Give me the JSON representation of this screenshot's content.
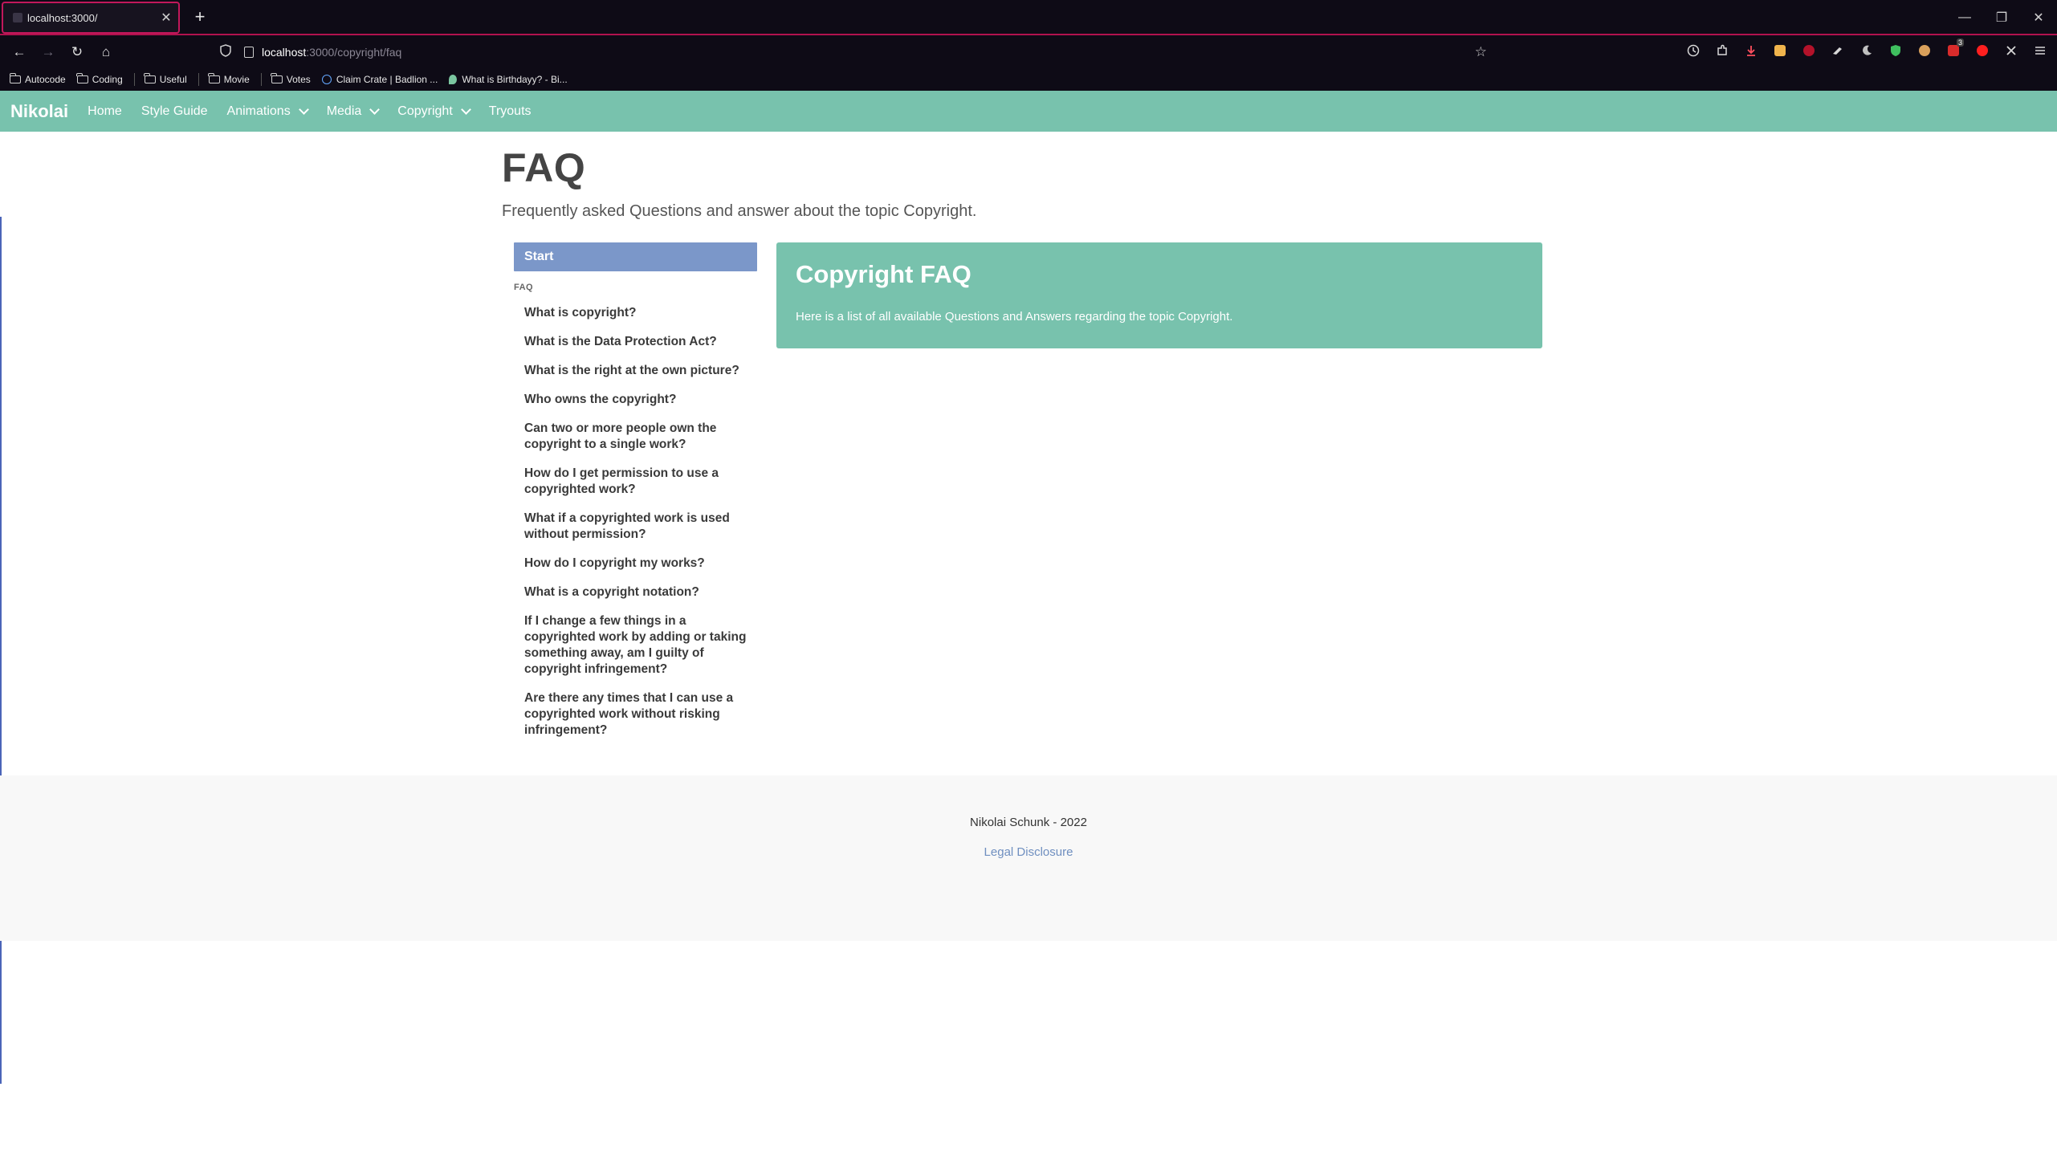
{
  "browser": {
    "tab": {
      "title": "localhost:3000/",
      "close": "✕"
    },
    "new_tab": "+",
    "window": {
      "minimize": "—",
      "restore": "❐",
      "close": "✕"
    },
    "nav": {
      "back": "←",
      "forward": "→",
      "reload": "↻",
      "home": "⌂"
    },
    "url": {
      "host": "localhost",
      "path": ":3000/copyright/faq"
    },
    "bookmark_star": "☆",
    "bookmarks": [
      {
        "label": "Autocode",
        "icon": "folder-icon"
      },
      {
        "label": "Coding",
        "icon": "folder-icon"
      },
      {
        "label": "Useful",
        "icon": "folder-icon"
      },
      {
        "label": "Movie",
        "icon": "folder-icon"
      },
      {
        "label": "Votes",
        "icon": "folder-icon"
      },
      {
        "label": "Claim Crate | Badlion ...",
        "icon": "globe-icon"
      },
      {
        "label": "What is Birthdayy? - Bi...",
        "icon": "leaf-icon"
      }
    ],
    "extension_badge": "3",
    "colors": {
      "chrome_bg": "#0e0b16",
      "tab_accent": "#c2185b"
    }
  },
  "site": {
    "brand": "Nikolai",
    "nav": {
      "home": "Home",
      "style_guide": "Style Guide",
      "animations": "Animations",
      "media": "Media",
      "copyright": "Copyright",
      "tryouts": "Tryouts"
    },
    "colors": {
      "primary": "#78c2ad",
      "secondary": "#7b97c9"
    }
  },
  "page": {
    "title": "FAQ",
    "lead": "Frequently asked Questions and answer about the topic Copyright."
  },
  "sidebar": {
    "start": "Start",
    "heading": "FAQ",
    "items": [
      "What is copyright?",
      "What is the Data Protection Act?",
      "What is the right at the own picture?",
      "Who owns the copyright?",
      "Can two or more people own the copyright to a single work?",
      "How do I get permission to use a copyrighted work?",
      "What if a copyrighted work is used without permission?",
      "How do I copyright my works?",
      "What is a copyright notation?",
      "If I change a few things in a copyrighted work by adding or taking something away, am I guilty of copyright infringement?",
      "Are there any times that I can use a copyrighted work without risking infringement?"
    ]
  },
  "card": {
    "title": "Copyright FAQ",
    "text": "Here is a list of all available Questions and Answers regarding the topic Copyright."
  },
  "footer": {
    "copyright": "Nikolai Schunk - 2022",
    "legal": "Legal Disclosure"
  }
}
